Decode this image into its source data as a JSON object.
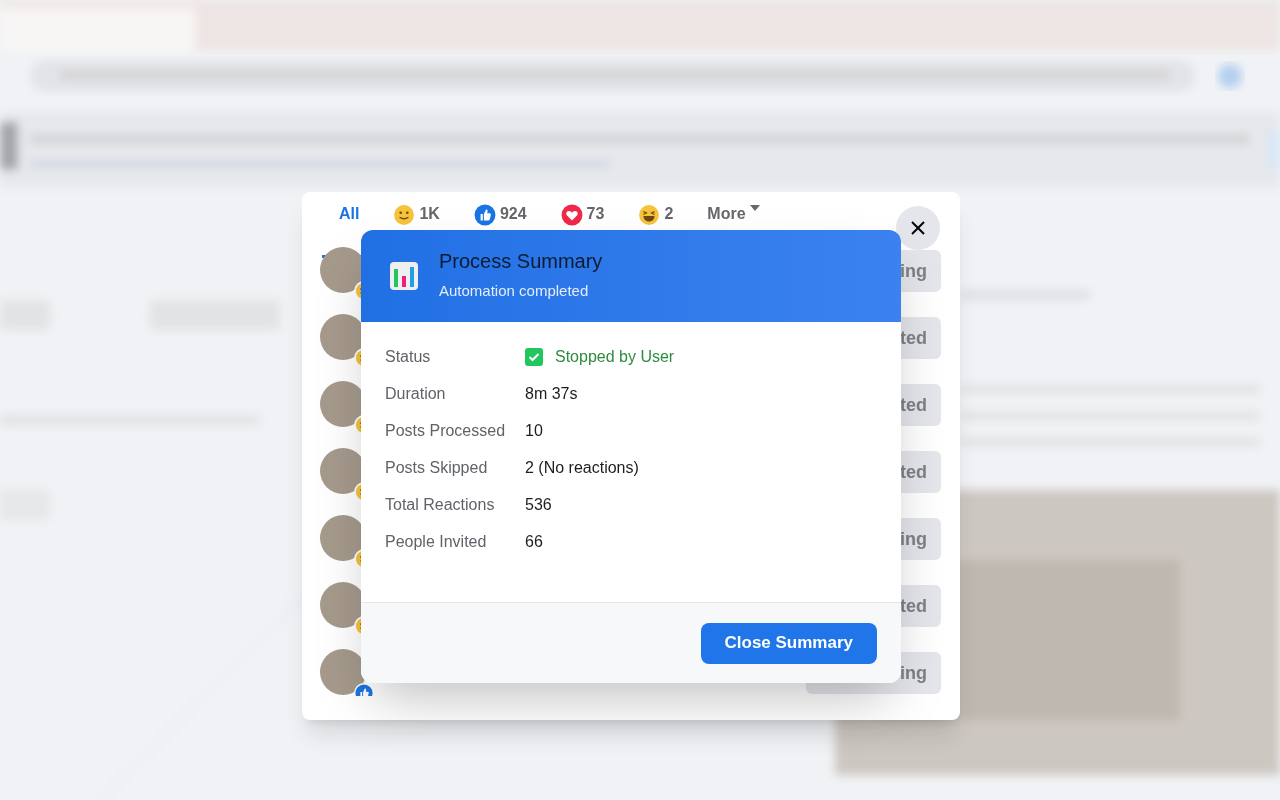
{
  "reactions_dialog": {
    "tabs": [
      {
        "kind": "all",
        "label": "All",
        "selected": true
      },
      {
        "kind": "care",
        "label": "1K",
        "selected": false
      },
      {
        "kind": "like",
        "label": "924",
        "selected": false
      },
      {
        "kind": "love",
        "label": "73",
        "selected": false
      },
      {
        "kind": "haha",
        "label": "2",
        "selected": false
      },
      {
        "kind": "more",
        "label": "More",
        "selected": false
      }
    ],
    "people": [
      {
        "kind": "care",
        "button": "ing"
      },
      {
        "kind": "care",
        "button": "ted"
      },
      {
        "kind": "care",
        "button": "ted"
      },
      {
        "kind": "care",
        "button": "ted"
      },
      {
        "kind": "care",
        "button": "ing"
      },
      {
        "kind": "care",
        "button": "ted"
      },
      {
        "kind": "like",
        "button": "ing"
      }
    ]
  },
  "summary": {
    "title": "Process Summary",
    "subtitle": "Automation completed",
    "rows": [
      {
        "kind": "status",
        "label": "Status",
        "value": "Stopped by User"
      },
      {
        "kind": "plain",
        "label": "Duration",
        "value": "8m 37s"
      },
      {
        "kind": "plain",
        "label": "Posts Processed",
        "value": "10"
      },
      {
        "kind": "plain",
        "label": "Posts Skipped",
        "value": "2 (No reactions)"
      },
      {
        "kind": "plain",
        "label": "Total Reactions",
        "value": "536"
      },
      {
        "kind": "plain",
        "label": "People Invited",
        "value": "66"
      }
    ],
    "button": "Close Summary"
  }
}
